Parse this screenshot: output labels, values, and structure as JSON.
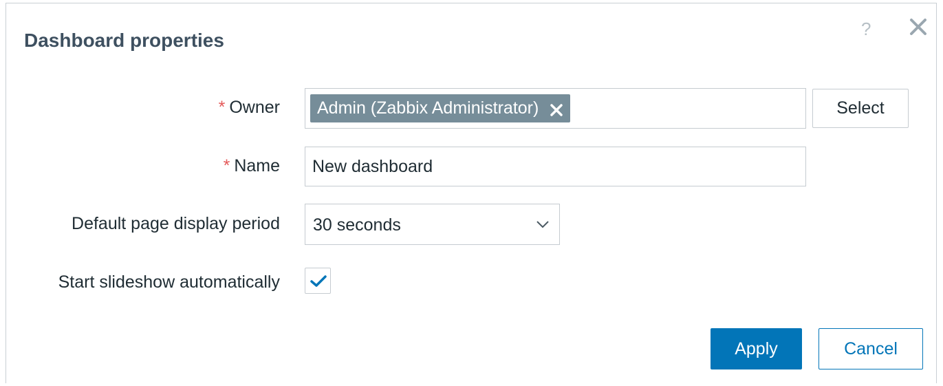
{
  "dialog": {
    "title": "Dashboard properties",
    "help_icon": "?",
    "close_icon": "close-icon"
  },
  "form": {
    "owner": {
      "required_mark": "*",
      "label": "Owner",
      "selected_tag": "Admin (Zabbix Administrator)",
      "select_button": "Select"
    },
    "name": {
      "required_mark": "*",
      "label": "Name",
      "value": "New dashboard"
    },
    "period": {
      "label": "Default page display period",
      "value": "30 seconds"
    },
    "slideshow": {
      "label": "Start slideshow automatically",
      "checked": true
    }
  },
  "footer": {
    "apply_label": "Apply",
    "cancel_label": "Cancel"
  },
  "colors": {
    "primary": "#0275b8",
    "tag_bg": "#768d99",
    "required": "#e45959",
    "title": "#3e5060"
  }
}
